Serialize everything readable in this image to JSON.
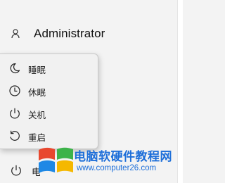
{
  "account": {
    "user_name": "Administrator",
    "icon": "person-icon"
  },
  "power_menu": {
    "items": [
      {
        "label": "睡眠",
        "icon": "sleep-moon-icon"
      },
      {
        "label": "休眠",
        "icon": "hibernate-clock-icon"
      },
      {
        "label": "关机",
        "icon": "shutdown-power-icon"
      },
      {
        "label": "重启",
        "icon": "restart-icon"
      }
    ]
  },
  "power_button": {
    "label": "电源",
    "icon": "power-icon"
  },
  "watermark": {
    "title": "电脑软硬件教程网",
    "url": "www.computer26.com"
  },
  "colors": {
    "background": "#f3f3f3",
    "menu_background": "#f1f1f1",
    "watermark_blue": "#1e6fd9",
    "logo_red": "#e8482f",
    "logo_green": "#3db34a",
    "logo_blue": "#1e88e5",
    "logo_yellow": "#f5b800"
  }
}
